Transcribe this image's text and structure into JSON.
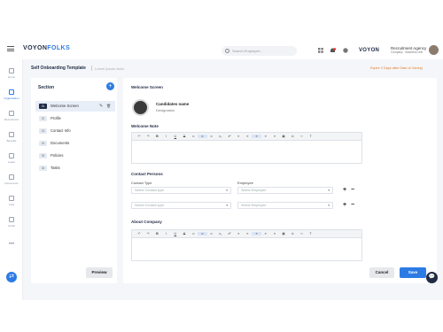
{
  "header": {
    "logo_main": "VOYON",
    "logo_accent": "FOLKS",
    "search_placeholder": "Search Employee...",
    "brand_right": "VOYON",
    "agency_name": "Recruitment Agency",
    "agency_sub": "Company · Business Unit"
  },
  "sidebar": {
    "items": [
      {
        "label": "Home"
      },
      {
        "label": "Organization"
      },
      {
        "label": "Recruitment"
      },
      {
        "label": "Benefits"
      },
      {
        "label": "Leave"
      },
      {
        "label": "Documents"
      },
      {
        "label": "Jobs"
      },
      {
        "label": "Goals"
      },
      {
        "label": "•••"
      }
    ]
  },
  "page": {
    "title": "Self Onboarding Template",
    "subtitle": "Lorem ipsum dolor",
    "right_note": "Expire 2 Days after Date of Joining"
  },
  "section_panel": {
    "title": "Section",
    "add_icon": "+",
    "items": [
      {
        "num": "01",
        "label": "Welcome Screen"
      },
      {
        "num": "02",
        "label": "Profile"
      },
      {
        "num": "03",
        "label": "Contact Info"
      },
      {
        "num": "04",
        "label": "Documents"
      },
      {
        "num": "05",
        "label": "Policies"
      },
      {
        "num": "06",
        "label": "Tasks"
      }
    ],
    "edit_icon": "✎",
    "delete_icon": "🗑",
    "preview_label": "Preview"
  },
  "main": {
    "welcome_screen_title": "Welcome Screen",
    "candidate_name": "Candidates name",
    "candidate_designation": "Designation",
    "welcome_note_title": "Welcome Note",
    "contact_persons_title": "Contact Persons",
    "contact_type_label": "Contact Type",
    "employee_label": "Employee",
    "contact_type_placeholder": "Select Contact type",
    "employee_placeholder": "Select Employee",
    "about_company_title": "About Company",
    "plus": "+",
    "minus": "−",
    "caret": "▾"
  },
  "toolbar_buttons": [
    "↶",
    "↷",
    "B",
    "I",
    "U",
    "S",
    "∞",
    "∞",
    "∞",
    "x₂",
    "x²",
    "≡",
    "≡",
    "≡",
    "≡",
    "≡",
    "▣",
    "⊙",
    "‹›",
    "T"
  ],
  "footer": {
    "cancel_label": "Cancel",
    "save_label": "Save",
    "chat_icon": "💬",
    "fab_icon": "⇄"
  },
  "colors": {
    "primary": "#2c7be5",
    "dark": "#1f2a44",
    "accent_orange": "#e0802b"
  }
}
